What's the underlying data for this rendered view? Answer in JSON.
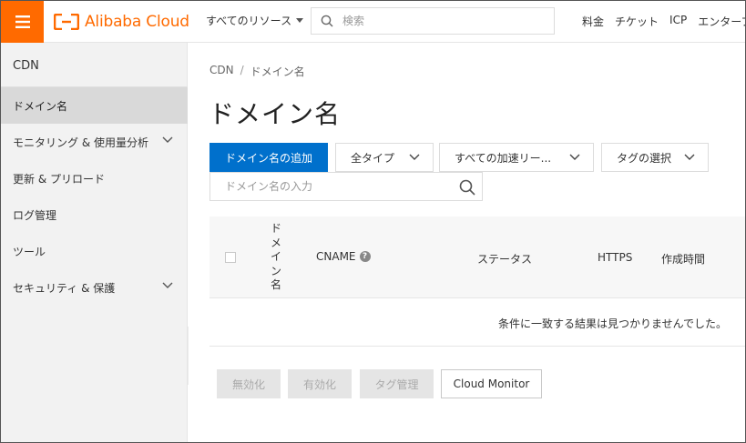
{
  "header": {
    "brand": "Alibaba Cloud",
    "resources_label": "すべてのリソース",
    "search_placeholder": "検索",
    "links": [
      "料金",
      "チケット",
      "ICP",
      "エンタープ"
    ]
  },
  "sidebar": {
    "title": "CDN",
    "items": [
      {
        "label": "ドメイン名",
        "active": true,
        "expandable": false
      },
      {
        "label": "モニタリング & 使用量分析",
        "active": false,
        "expandable": true
      },
      {
        "label": "更新 & プリロード",
        "active": false,
        "expandable": false
      },
      {
        "label": "ログ管理",
        "active": false,
        "expandable": false
      },
      {
        "label": "ツール",
        "active": false,
        "expandable": false
      },
      {
        "label": "セキュリティ & 保護",
        "active": false,
        "expandable": true
      }
    ]
  },
  "main": {
    "breadcrumb": [
      "CDN",
      "ドメイン名"
    ],
    "breadcrumb_separator": "/",
    "title": "ドメイン名",
    "add_button": "ドメイン名の追加",
    "filters": {
      "type": "全タイプ",
      "acceleration": "すべての加速リー...",
      "tags": "タグの選択"
    },
    "domain_search_placeholder": "ドメイン名の入力",
    "table": {
      "columns": {
        "domain": "ドメイン名",
        "cname": "CNAME",
        "cname_help": "?",
        "status": "ステータス",
        "https": "HTTPS",
        "created": "作成時間"
      },
      "empty_message": "条件に一致する結果は見つかりませんでした。"
    },
    "bulk_actions": {
      "disable": "無効化",
      "enable": "有効化",
      "tag_manage": "タグ管理",
      "cloud_monitor": "Cloud Monitor"
    }
  },
  "colors": {
    "brand": "#ff6a00",
    "primary": "#0070cc",
    "sidebar_bg": "#f2f2f2",
    "sidebar_active": "#d9d9d9"
  }
}
